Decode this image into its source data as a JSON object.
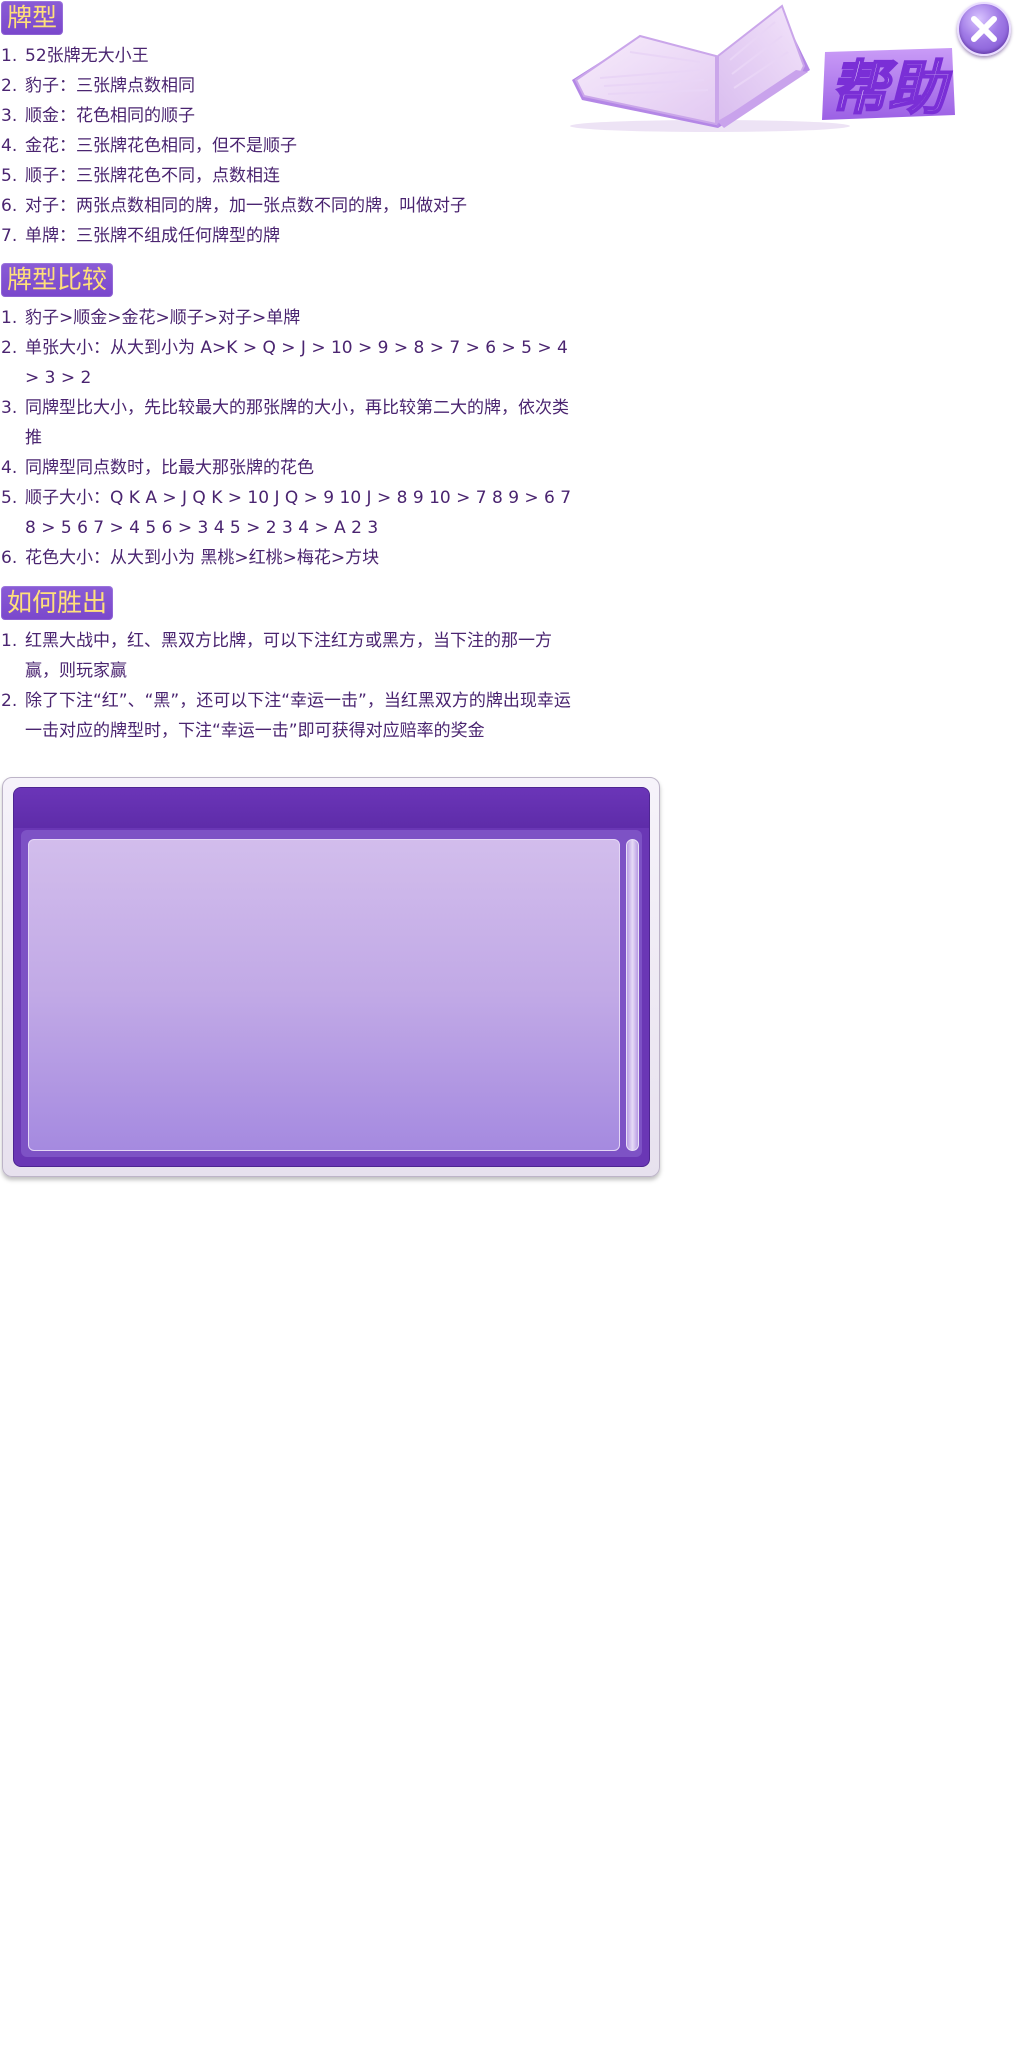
{
  "sections": [
    {
      "title": "牌型",
      "items": [
        {
          "num": "1.",
          "text": "52张牌无大小王"
        },
        {
          "num": "2.",
          "text": "豹子：三张牌点数相同"
        },
        {
          "num": "3.",
          "text": "顺金：花色相同的顺子"
        },
        {
          "num": "4.",
          "text": "金花：三张牌花色相同，但不是顺子"
        },
        {
          "num": "5.",
          "text": "顺子：三张牌花色不同，点数相连"
        },
        {
          "num": "6.",
          "text": "对子：两张点数相同的牌，加一张点数不同的牌，叫做对子"
        },
        {
          "num": "7.",
          "text": "单牌：三张牌不组成任何牌型的牌"
        }
      ]
    },
    {
      "title": "牌型比较",
      "items": [
        {
          "num": "1.",
          "text": "豹子>顺金>金花>顺子>对子>单牌"
        },
        {
          "num": "2.",
          "text": "单张大小：从大到小为 A>K > Q > J > 10 > 9 > 8 > 7 > 6 > 5 > 4 > 3 > 2"
        },
        {
          "num": "3.",
          "text": "同牌型比大小，先比较最大的那张牌的大小，再比较第二大的牌，依次类推"
        },
        {
          "num": "4.",
          "text": "同牌型同点数时，比最大那张牌的花色"
        },
        {
          "num": "5.",
          "text": "顺子大小：Q K A > J Q K > 10 J Q > 9 10 J > 8 9 10 > 7 8 9 > 6 7 8 > 5 6 7 > 4 5 6 > 3 4 5 > 2 3 4 > A 2 3"
        },
        {
          "num": "6.",
          "text": "花色大小：从大到小为 黑桃>红桃>梅花>方块"
        }
      ]
    },
    {
      "title": "如何胜出",
      "items": [
        {
          "num": "1.",
          "text": "红黑大战中，红、黑双方比牌，可以下注红方或黑方，当下注的那一方赢，则玩家赢"
        },
        {
          "num": "2.",
          "text": "除了下注“红”、“黑”，还可以下注“幸运一击”，当红黑双方的牌出现幸运一击对应的牌型时，下注“幸运一击”即可获得对应赔率的奖金"
        }
      ]
    }
  ],
  "header": {
    "title": "帮助",
    "book_icon": "open-book-icon",
    "close_icon": "close-icon"
  },
  "colors": {
    "badge_bg": "#7a47cc",
    "badge_text": "#ffe07a",
    "body_text": "#4a2470",
    "panel_frame": "#6a37b5"
  }
}
